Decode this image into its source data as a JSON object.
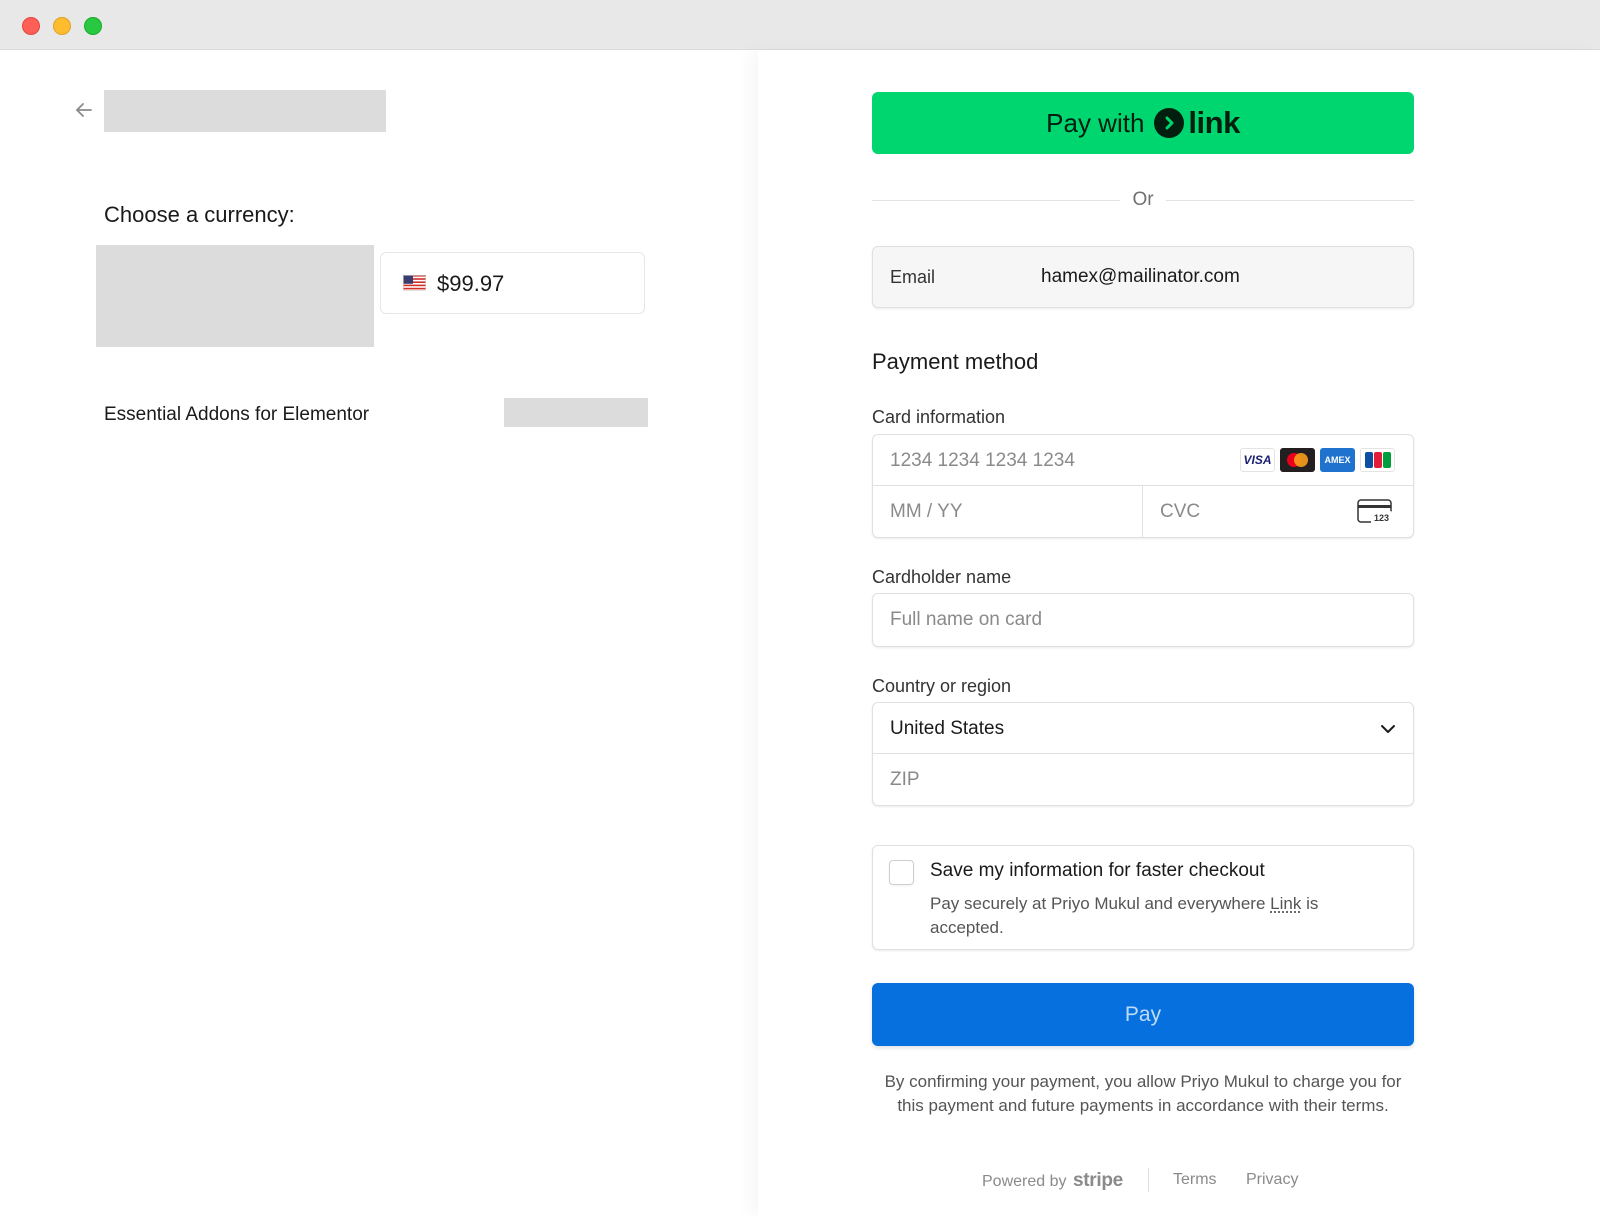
{
  "window": {
    "colors": {
      "close": "#fe5f57",
      "minimize": "#febc2e",
      "maximize": "#28c840"
    }
  },
  "summary": {
    "back_icon": "arrow-left-icon",
    "currency_title": "Choose a currency:",
    "currency_option": {
      "flag_icon": "us-flag-icon",
      "amount": "$99.97"
    },
    "product_name": "Essential Addons for Elementor"
  },
  "checkout": {
    "link_button": {
      "pay_with": "Pay with",
      "logo_text": "link",
      "color": "#00d66f"
    },
    "or_divider": "Or",
    "email": {
      "label": "Email",
      "value": "hamex@mailinator.com"
    },
    "payment_method_title": "Payment method",
    "card": {
      "label": "Card information",
      "number_placeholder": "1234 1234 1234 1234",
      "expiry_placeholder": "MM / YY",
      "cvc_placeholder": "CVC",
      "brands": [
        "visa-icon",
        "mastercard-icon",
        "amex-icon",
        "jcb-icon"
      ],
      "visa_text": "VISA",
      "amex_text": "AMEX",
      "cvc_icon_text": "123"
    },
    "cardholder": {
      "label": "Cardholder name",
      "placeholder": "Full name on card"
    },
    "country": {
      "label": "Country or region",
      "value": "United States",
      "zip_placeholder": "ZIP"
    },
    "save_info": {
      "checked": false,
      "title": "Save my information for faster checkout",
      "desc_before": "Pay securely at Priyo Mukul and everywhere ",
      "desc_link": "Link",
      "desc_after": " is accepted."
    },
    "pay_button": {
      "label": "Pay",
      "color": "#0570de"
    },
    "legal": "By confirming your payment, you allow Priyo Mukul to charge you for this payment and future payments in accordance with their terms.",
    "footer": {
      "powered_by": "Powered by",
      "brand": "stripe",
      "terms": "Terms",
      "privacy": "Privacy"
    }
  }
}
